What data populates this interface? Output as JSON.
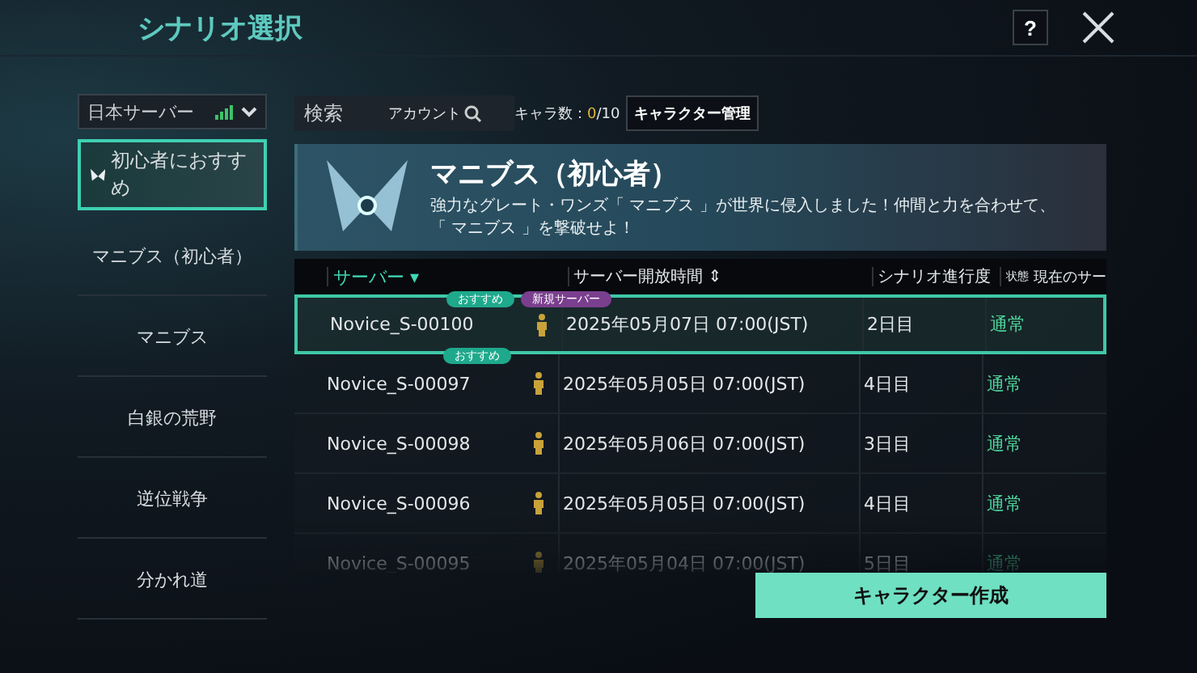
{
  "header": {
    "title": "シナリオ選択",
    "help_button": "?"
  },
  "server_select": {
    "value": "日本サーバー"
  },
  "sidebar": {
    "items": [
      {
        "label": "初心者におすすめ",
        "selected": true
      },
      {
        "label": "マニブス（初心者）",
        "selected": false
      },
      {
        "label": "マニブス",
        "selected": false
      },
      {
        "label": "白銀の荒野",
        "selected": false
      },
      {
        "label": "逆位戦争",
        "selected": false
      },
      {
        "label": "分かれ道",
        "selected": false
      }
    ]
  },
  "toolbar": {
    "search": {
      "placeholder": "検索",
      "scope": "アカウント"
    },
    "char_count_label": "キャラ数：",
    "char_count_current": "0",
    "char_count_max": "/10",
    "manage_button": "キャラクター管理"
  },
  "banner": {
    "title": "マニブス（初心者）",
    "lines": [
      "強力なグレート・ワンズ「 マニブス 」が世界に侵入しました！仲間と力を合わせて、",
      "「 マニブス 」を撃破せよ！"
    ]
  },
  "table": {
    "columns": [
      {
        "label": "サーバー",
        "sort": "▾"
      },
      {
        "label": "サーバー開放時間",
        "sort": "⇕"
      },
      {
        "label": "シナリオ進行度"
      },
      {
        "label": "状態"
      },
      {
        "label": "現在のサー"
      }
    ],
    "rows": [
      {
        "server": "Novice_S-00100",
        "badges": [
          {
            "label": "おすすめ",
            "color": "#1fa98c"
          },
          {
            "label": "新規サーバー",
            "color": "#7a3f8e"
          }
        ],
        "open_time": "2025年05月07日 07:00(JST)",
        "progress": "2日目",
        "status": "通常",
        "selected": true
      },
      {
        "server": "Novice_S-00097",
        "badges": [
          {
            "label": "おすすめ",
            "color": "#1fa98c"
          }
        ],
        "open_time": "2025年05月05日 07:00(JST)",
        "progress": "4日目",
        "status": "通常",
        "selected": false
      },
      {
        "server": "Novice_S-00098",
        "badges": [],
        "open_time": "2025年05月06日 07:00(JST)",
        "progress": "3日目",
        "status": "通常",
        "selected": false
      },
      {
        "server": "Novice_S-00096",
        "badges": [],
        "open_time": "2025年05月05日 07:00(JST)",
        "progress": "4日目",
        "status": "通常",
        "selected": false
      },
      {
        "server": "Novice_S-00095",
        "badges": [],
        "open_time": "2025年05月04日 07:00(JST)",
        "progress": "5日目",
        "status": "通常",
        "selected": false
      }
    ]
  },
  "create_button": "キャラクター作成"
}
